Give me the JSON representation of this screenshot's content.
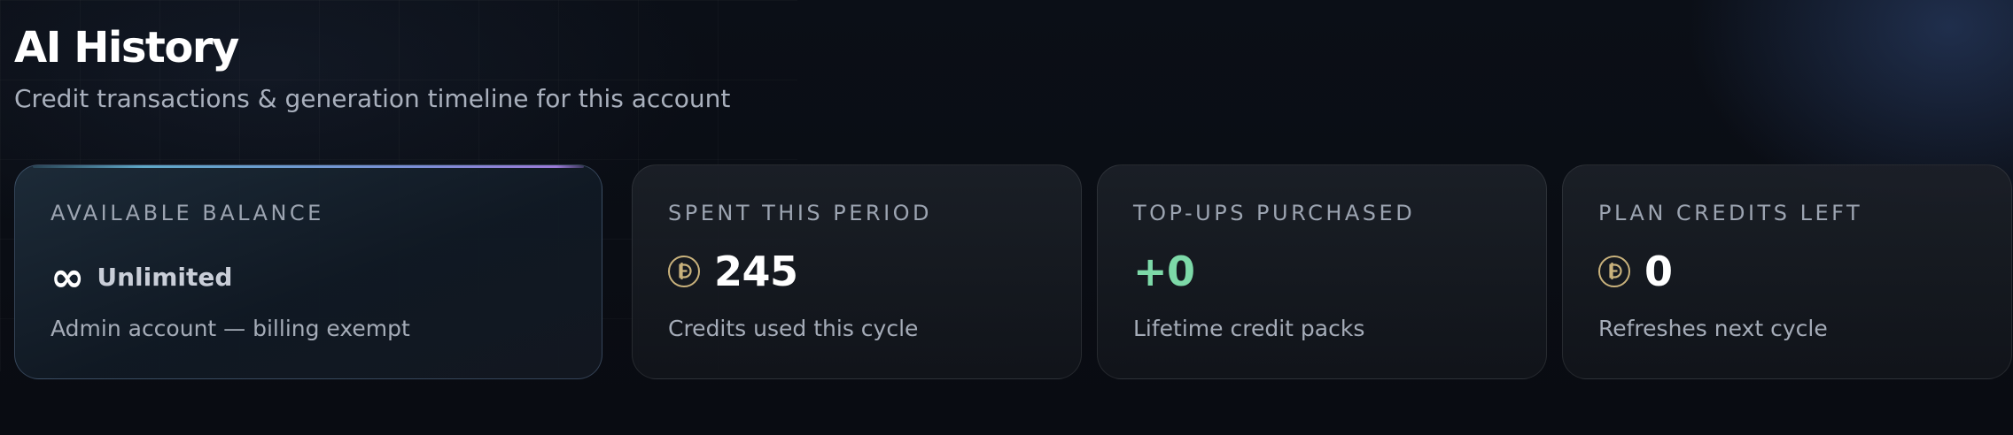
{
  "header": {
    "title": "AI History",
    "subtitle": "Credit transactions & generation timeline for this account"
  },
  "cards": [
    {
      "label": "AVAILABLE BALANCE",
      "icon": "infinity-icon",
      "icon_glyph": "∞",
      "value": "Unlimited",
      "caption": "Admin account — billing exempt"
    },
    {
      "label": "SPENT THIS PERIOD",
      "icon": "credit-coin-icon",
      "value": "245",
      "caption": "Credits used this cycle"
    },
    {
      "label": "TOP-UPS PURCHASED",
      "value": "+0",
      "value_color": "#7dd9a8",
      "caption": "Lifetime credit packs"
    },
    {
      "label": "PLAN CREDITS LEFT",
      "icon": "credit-coin-icon",
      "value": "0",
      "caption": "Refreshes next cycle"
    }
  ],
  "colors": {
    "accent_gradient_start": "#5fa8c8",
    "accent_gradient_end": "#9b7ad8",
    "coin": "#c9b27c",
    "positive": "#7dd9a8"
  }
}
